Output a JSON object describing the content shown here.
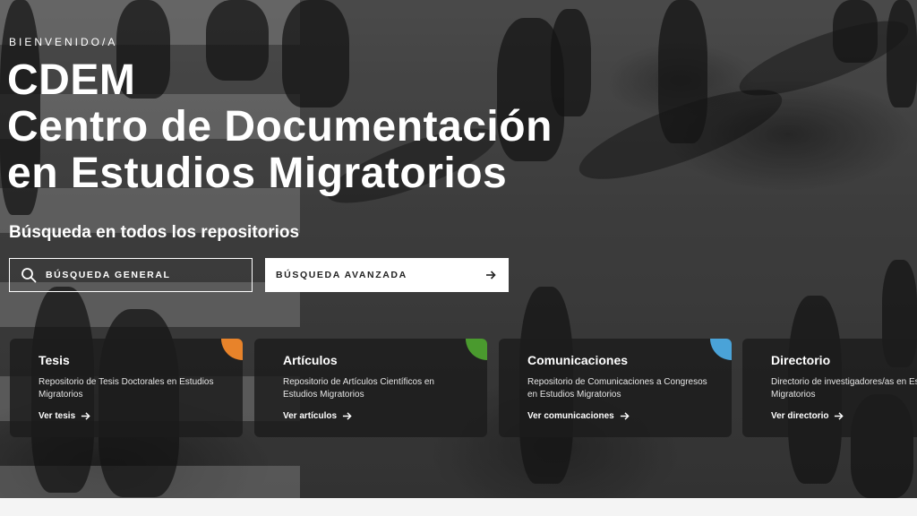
{
  "hero": {
    "eyebrow": "BIENVENIDO/A",
    "title_line1": "CDEM",
    "title_line2": "Centro de Documentación",
    "title_line3": "en Estudios Migratorios",
    "subtitle": "Búsqueda en todos los repositorios"
  },
  "search": {
    "general_label": "BÚSQUEDA GENERAL",
    "advanced_label": "BÚSQUEDA AVANZADA"
  },
  "cards": [
    {
      "title": "Tesis",
      "description": "Repositorio de Tesis Doctorales en Estudios Migratorios",
      "link": "Ver tesis",
      "accent": "#e8832a"
    },
    {
      "title": "Artículos",
      "description": "Repositorio de Artículos Científicos en Estudios Migratorios",
      "link": "Ver artículos",
      "accent": "#4a9a2e"
    },
    {
      "title": "Comunicaciones",
      "description": "Repositorio de Comunicaciones a Congresos en Estudios Migratorios",
      "link": "Ver comunicaciones",
      "accent": "#4aa3d8"
    },
    {
      "title": "Directorio",
      "description": "Directorio de investigadores/as en Estudios Migratorios",
      "link": "Ver directorio",
      "accent": ""
    }
  ],
  "icons": {
    "search": "search-icon",
    "arrow": "arrow-right-icon"
  }
}
